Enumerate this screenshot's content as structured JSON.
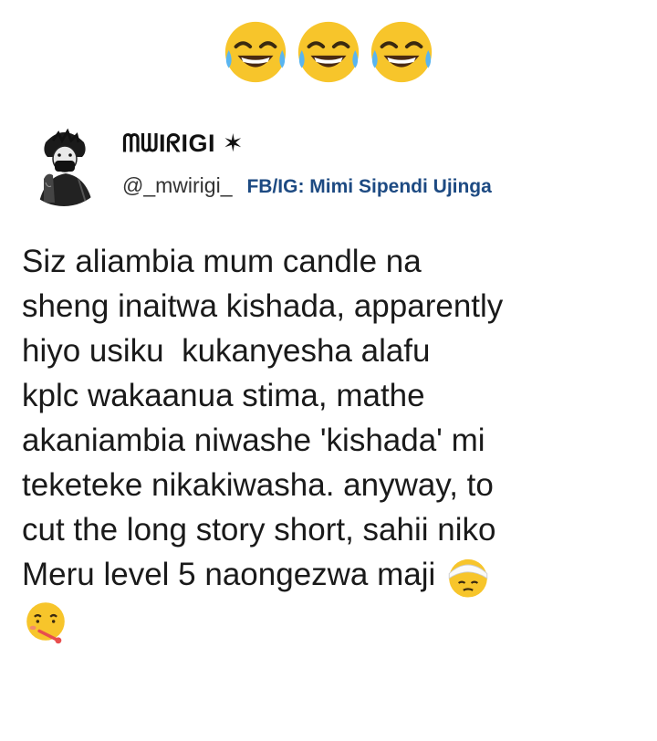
{
  "top_emojis": [
    "tears-of-joy-emoji",
    "tears-of-joy-emoji",
    "tears-of-joy-emoji"
  ],
  "profile": {
    "display_name": "ᗰᗯIᖇIGI ✶",
    "handle": "@_mwirigi_",
    "page_tag": "FB/IG: Mimi Sipendi Ujinga",
    "accent_color": "#1d4a82"
  },
  "post": {
    "lines": [
      "Siz aliambia mum candle na",
      "sheng inaitwa kishada, apparently",
      "hiyo usiku  kukanyesha alafu",
      "kplc wakaanua stima, mathe",
      "akaniambia niwashe 'kishada' mi",
      "teketeke nikakiwasha. anyway, to",
      "cut the long story short, sahii niko",
      "Meru level 5 naongezwa maji"
    ],
    "trailing_emojis": [
      "head-bandage-emoji",
      "thermometer-face-emoji"
    ]
  }
}
